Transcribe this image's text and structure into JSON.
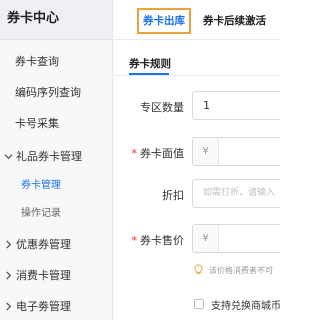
{
  "sidebar": {
    "title": "券卡中心",
    "items": [
      {
        "label": "券卡查询"
      },
      {
        "label": "编码序列查询"
      },
      {
        "label": "卡号采集"
      }
    ],
    "groups": [
      {
        "label": "礼品券卡管理",
        "expanded": true,
        "children": [
          {
            "label": "券卡管理",
            "active": true
          },
          {
            "label": "操作记录"
          }
        ]
      },
      {
        "label": "优惠券管理",
        "expanded": false
      },
      {
        "label": "消费卡管理",
        "expanded": false
      },
      {
        "label": "电子劵管理",
        "expanded": false
      }
    ]
  },
  "tabs": [
    {
      "label": "券卡出库",
      "active": true
    },
    {
      "label": "券卡后续激活",
      "active": false
    }
  ],
  "section": {
    "title": "券卡规则"
  },
  "form": {
    "zone_count": {
      "label": "专区数量",
      "value": "1"
    },
    "face_value": {
      "label": "券卡面值",
      "required": true,
      "prefix": "¥",
      "value": ""
    },
    "discount": {
      "label": "折扣",
      "placeholder": "如需打折，请输入"
    },
    "sale_price": {
      "label": "券卡售价",
      "required": true,
      "prefix": "¥",
      "value": ""
    },
    "price_hint": "该价格消费者不可",
    "support_exchange": {
      "label": "支持兑换商城币",
      "checked": false
    }
  },
  "colors": {
    "accent": "#1a73e8",
    "highlight_border": "#e8a33d",
    "required": "#f5222d"
  }
}
